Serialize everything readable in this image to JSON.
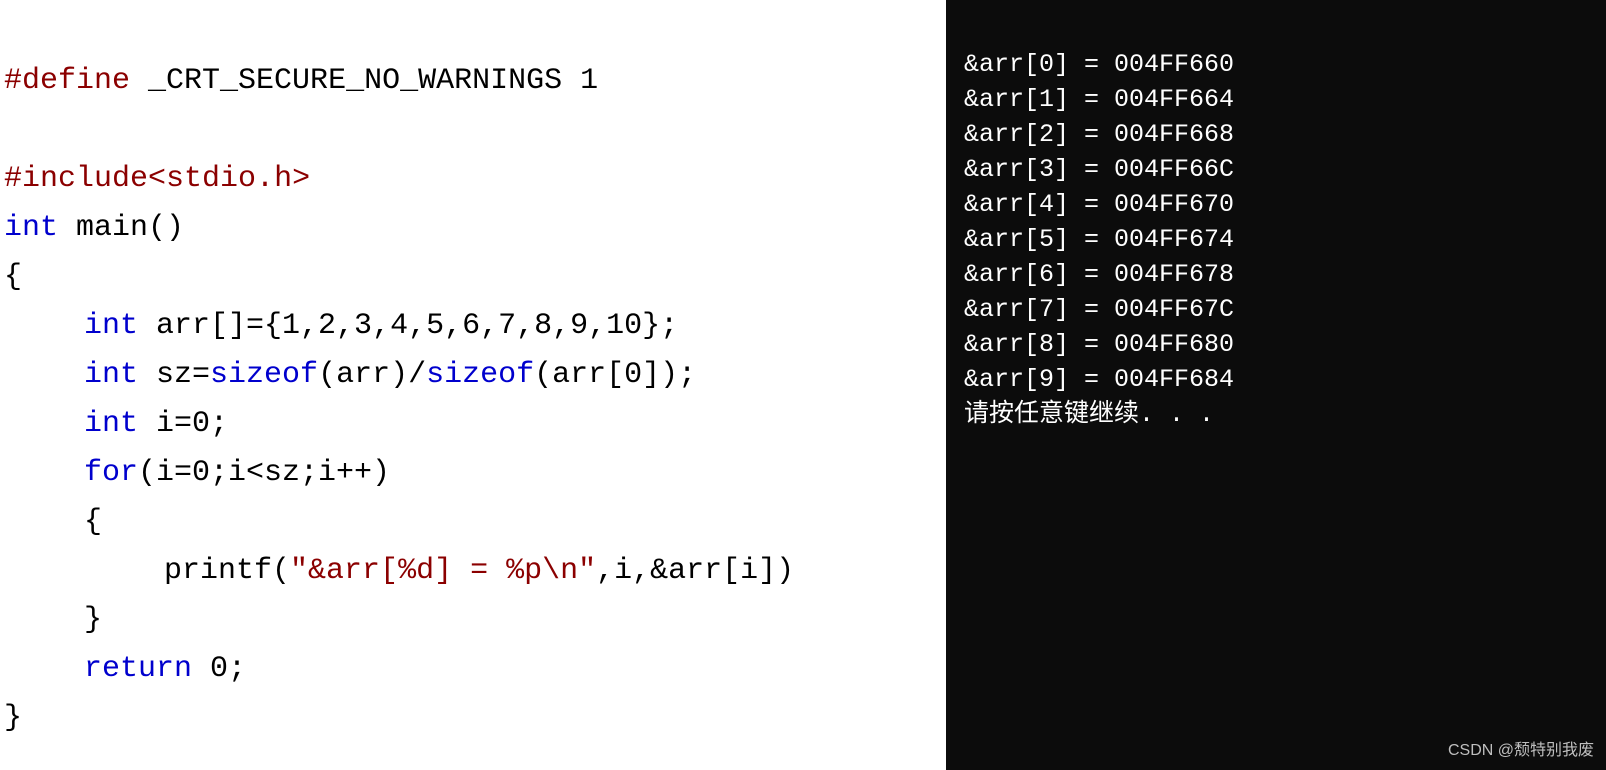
{
  "code": {
    "define_directive": "#define",
    "define_macro": " _CRT_SECURE_NO_WARNINGS 1",
    "include_directive": "#include",
    "include_open": "<",
    "include_file": "stdio.h",
    "include_close": ">",
    "kw_int": "int",
    "main_name": " main",
    "parens": "()",
    "brace_open": "{",
    "brace_close": "}",
    "arr_decl_ident": " arr[]=",
    "arr_decl_values": "{1,2,3,4,5,6,7,8,9,10};",
    "sz_decl_ident": " sz=",
    "kw_sizeof": "sizeof",
    "sz_arr": "(arr)/",
    "sz_arr0": "(arr[0]);",
    "i_decl": " i=0;",
    "kw_for": "for",
    "for_cond": "(i=0;i<sz;i++)",
    "printf_name": "printf",
    "printf_open": "(",
    "printf_str": "\"&arr[%d] = %p\\n\"",
    "printf_args": ",i,&arr[i])",
    "printf_semi": "",
    "kw_return": "return",
    "return_val": " 0;"
  },
  "console": {
    "lines": [
      "&arr[0] = 004FF660",
      "&arr[1] = 004FF664",
      "&arr[2] = 004FF668",
      "&arr[3] = 004FF66C",
      "&arr[4] = 004FF670",
      "&arr[5] = 004FF674",
      "&arr[6] = 004FF678",
      "&arr[7] = 004FF67C",
      "&arr[8] = 004FF680",
      "&arr[9] = 004FF684"
    ],
    "prompt": "请按任意键继续. . ."
  },
  "watermark": "CSDN @颓特别我废"
}
